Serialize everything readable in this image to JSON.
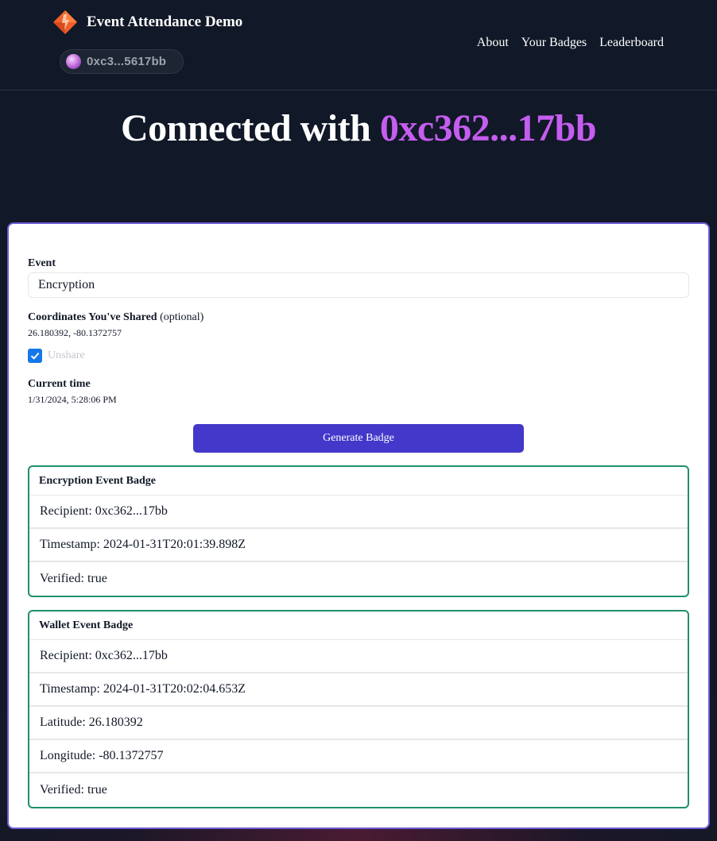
{
  "header": {
    "app_title": "Event Attendance Demo",
    "wallet_address": "0xc3...5617bb",
    "nav": [
      {
        "label": "About"
      },
      {
        "label": "Your Badges"
      },
      {
        "label": "Leaderboard"
      }
    ]
  },
  "hero": {
    "prefix": "Connected with",
    "address": "0xc362...17bb"
  },
  "form": {
    "event_label": "Event",
    "event_value": "Encryption",
    "coords_label": "Coordinates You've Shared",
    "coords_optional": "(optional)",
    "coords_value": "26.180392, -80.1372757",
    "unshare_label": "Unshare",
    "unshare_checked": true,
    "time_label": "Current time",
    "time_value": "1/31/2024, 5:28:06 PM",
    "generate_button": "Generate Badge"
  },
  "badges": [
    {
      "title": "Encryption Event Badge",
      "rows": [
        "Recipient: 0xc362...17bb",
        "Timestamp: 2024-01-31T20:01:39.898Z",
        "Verified: true"
      ]
    },
    {
      "title": "Wallet Event Badge",
      "rows": [
        "Recipient: 0xc362...17bb",
        "Timestamp: 2024-01-31T20:02:04.653Z",
        "Latitude: 26.180392",
        "Longitude: -80.1372757",
        "Verified: true"
      ]
    }
  ],
  "colors": {
    "background": "#111827",
    "accent_address": "#c55df0",
    "button": "#4338ca",
    "badge_border": "#1f8f6e",
    "card_border": "#6b5ad3"
  }
}
